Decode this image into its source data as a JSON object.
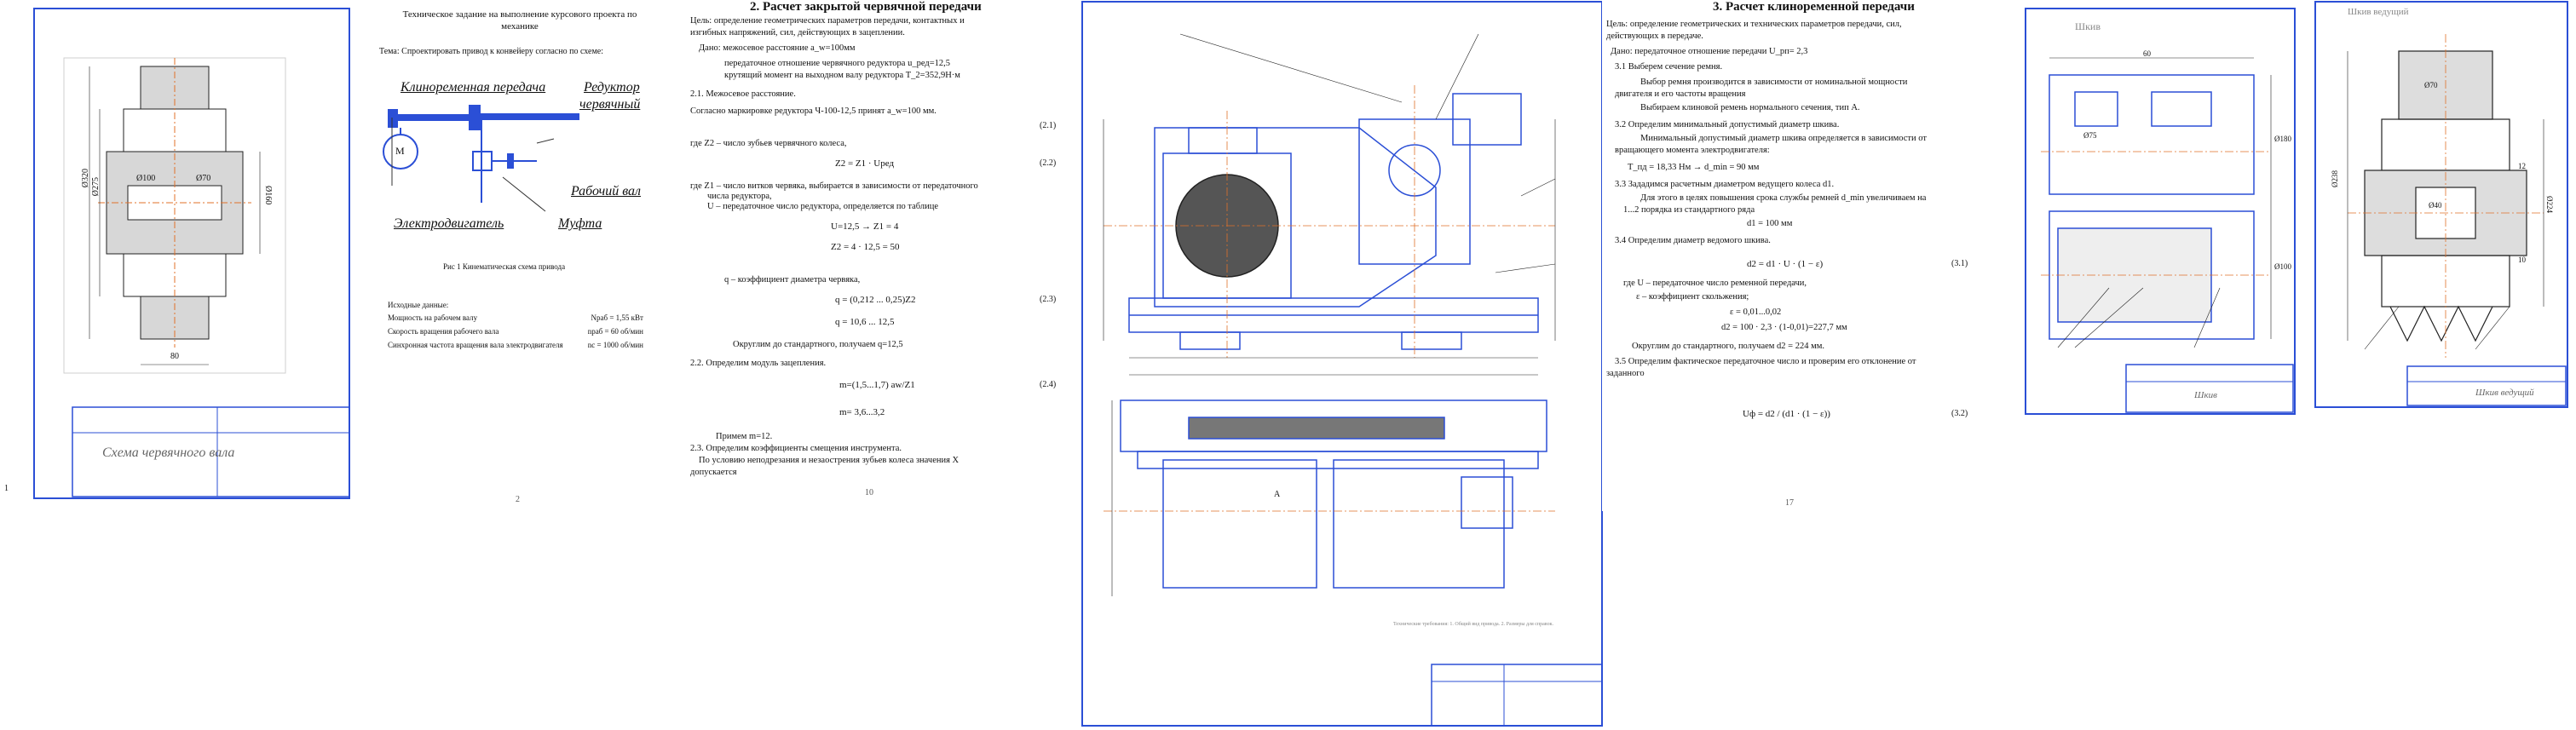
{
  "sheet1": {
    "stamp_title": "Схема червячного вала",
    "dims": [
      "Ø320",
      "Ø275",
      "Ø160",
      "80",
      "Ø100",
      "Ø70"
    ],
    "marker": "1"
  },
  "sheet2": {
    "header": "Техническое задание на выполнение курсового проекта по механике",
    "theme": "Тема: Спроектировать привод к конвейеру согласно по схеме:",
    "labels": {
      "belt": "Клиноременная передача",
      "reducer_1": "Редуктор",
      "reducer_2": "червячный",
      "work_shaft": "Рабочий вал",
      "motor": "Электродвигатель",
      "coupling": "Муфта",
      "motor_symbol": "М"
    },
    "caption": "Рис 1 Кинематическая схема привода",
    "source_title": "Исходные данные:",
    "rows": [
      {
        "label": "Мощность на рабочем валу",
        "value": "Nраб = 1,55 кВт"
      },
      {
        "label": "Скорость вращения рабочего вала",
        "value": "nраб = 60 об/мин"
      },
      {
        "label": "Синхронная частота вращения вала электродвигателя",
        "value": "nc = 1000 об/мин"
      }
    ],
    "page": "2"
  },
  "sheet3": {
    "title": "2. Расчет закрытой червячной передачи",
    "lines": [
      "Цель: определение геометрических параметров передачи, контактных и",
      "изгибных напряжений, сил, действующих в зацеплении.",
      "Дано: межосевое расстояние a_w=100мм",
      "передаточное отношение червячного редуктора u_ред=12,5",
      "крутящий момент на выходном валу редуктора T_2=352,9Н·м",
      "2.1. Межосевое расстояние.",
      "Согласно маркировке редуктора Ч-100-12,5 принят a_w=100 мм.",
      "где Z2 – число зубьев червячного колеса,",
      "где Z1 – число витков червяка, выбирается в зависимости от передаточного",
      "числа редуктора,",
      "U – передаточное число редуктора, определяется по таблице",
      "q – коэффициент диаметра червяка,",
      "Округлим до стандартного, получаем q=12,5",
      "2.2. Определим модуль зацепления.",
      "Примем m=12.",
      "2.3. Определим коэффициенты смещения инструмента.",
      "По условию неподрезания и незаострения зубьев колеса значения X",
      "допускается"
    ],
    "formulas": [
      {
        "expr": "Z2 = Z1 · Uред",
        "no": "(2.2)"
      },
      {
        "expr": "U=12,5  →  Z1 = 4",
        "no": ""
      },
      {
        "expr": "Z2 = 4 · 12,5 = 50",
        "no": ""
      },
      {
        "expr": "q = (0,212 ... 0,25)Z2",
        "no": "(2.3)"
      },
      {
        "expr": "q = 10,6 ... 12,5",
        "no": ""
      },
      {
        "expr": "m=(1,5...1,7) aw/Z1",
        "no": "(2.4)"
      },
      {
        "expr": "m= 3,6...3,2",
        "no": ""
      }
    ],
    "eq1": "(2.1)",
    "page": "10"
  },
  "sheet4": {
    "stamp_note": "Технические требования: 1. Общий вид привода. 2. Размеры для справок.",
    "marker": "A"
  },
  "sheet5": {
    "title": "3. Расчет клиноременной передачи",
    "lines": [
      "Цель: определение геометрических и технических параметров передачи, сил,",
      "действующих в передаче.",
      "Дано: передаточное отношение передачи U_рп= 2,3",
      "3.1 Выберем сечение ремня.",
      "Выбор ремня производится в зависимости от номинальной мощности",
      "двигателя и его частоты вращения",
      "Выбираем клиновой ремень нормального сечения, тип    А.",
      "3.2 Определим минимальный допустимый диаметр шкива.",
      "Минимальный допустимый диаметр шкива определяется в зависимости от",
      "вращающего момента электродвигателя:",
      "T_пд = 18,33 Нм  →  d_min = 90 мм",
      "3.3 Зададимся расчетным диаметром ведущего колеса d1.",
      "Для этого в целях повышения срока службы ремней  d_min  увеличиваем на",
      "1...2 порядка из стандартного ряда",
      "d1 = 100 мм",
      "3.4 Определим диаметр ведомого шкива.",
      "где U – передаточное число ременной передачи,",
      "ε – коэффициент скольжения;",
      "ε = 0,01...0,02",
      "d2 = 100 · 2,3 · (1-0,01)=227,7 мм",
      "Округлим до стандартного, получаем  d2 = 224 мм.",
      "3.5 Определим фактическое передаточное число и проверим его отклонение от",
      "заданного"
    ],
    "formula1": "d2 = d1 · U · (1 − ε)",
    "eq1": "(3.1)",
    "formula2": "Uф = d2 / (d1 · (1 − ε))",
    "eq2": "(3.2)",
    "page": "17"
  },
  "sheet6": {
    "stamp_title": "Шкив",
    "label_top": "Шкив",
    "notes": [
      "Ø180",
      "Ø100",
      "60",
      "Ø75"
    ]
  },
  "sheet7": {
    "stamp_title": "Шкив ведущий",
    "label_top": "Шкив ведущий",
    "notes": [
      "Ø238",
      "Ø224",
      "Ø40",
      "Ø70",
      "12",
      "10"
    ]
  },
  "colors": {
    "frame": "#2b4fd6",
    "hatch": "#555555",
    "center_line": "#e0702a",
    "ink": "#111111"
  }
}
